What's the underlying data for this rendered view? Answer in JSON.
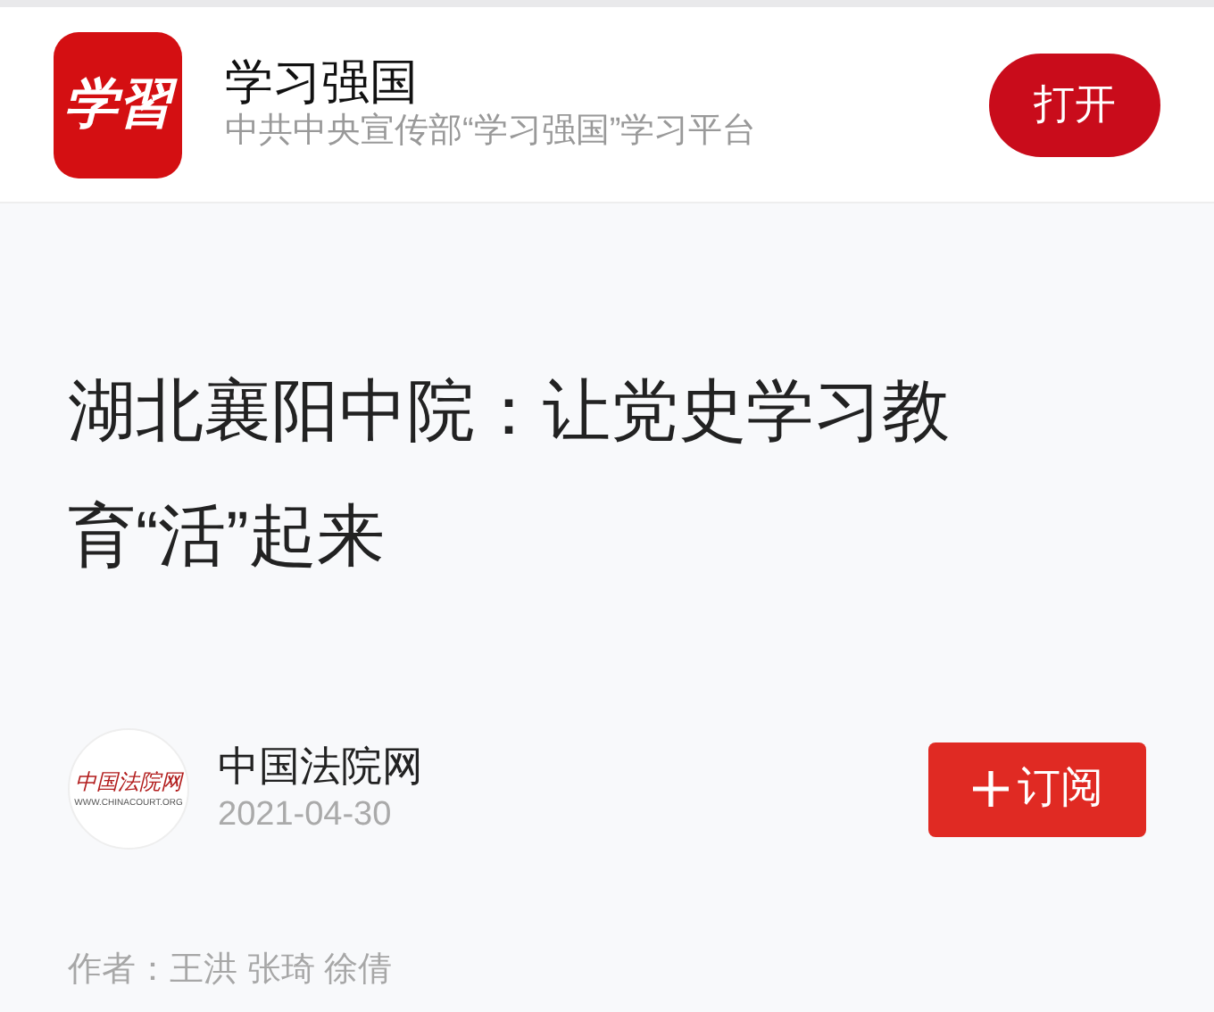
{
  "app_banner": {
    "logo_text": "学習",
    "title": "学习强国",
    "subtitle": "中共中央宣传部“学习强国”学习平台",
    "open_button": "打开"
  },
  "article": {
    "title": "湖北襄阳中院：让党史学习教育“活”起来",
    "source": {
      "logo_text": "中国法院网",
      "logo_url": "WWW.CHINACOURT.ORG",
      "name": "中国法院网",
      "date": "2021-04-30",
      "subscribe_button": "订阅",
      "subscribed": false
    },
    "author": "作者：王洪 张琦 徐倩"
  }
}
